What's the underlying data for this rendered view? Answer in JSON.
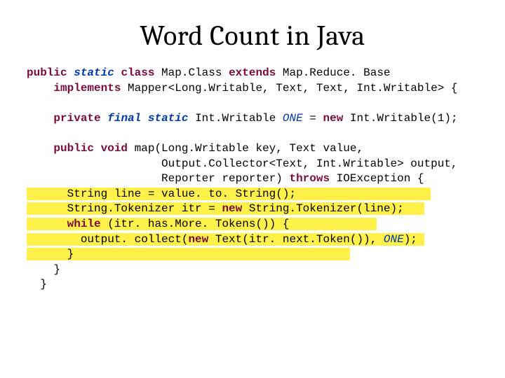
{
  "title": "Word Count in Java",
  "code": {
    "l1a": "public",
    "l1b": " ",
    "l1c": "static",
    "l1d": " ",
    "l1e": "class",
    "l1f": " Map.Class ",
    "l1g": "extends",
    "l1h": " Map.Reduce. Base",
    "l2a": "    ",
    "l2b": "implements",
    "l2c": " Mapper<Long.Writable, Text, Text, Int.Writable> {",
    "l3": " ",
    "l4a": "    ",
    "l4b": "private",
    "l4c": " ",
    "l4d": "final",
    "l4e": " ",
    "l4f": "static",
    "l4g": " Int.Writable ",
    "l4h": "ONE",
    "l4i": " = ",
    "l4j": "new",
    "l4k": " Int.Writable(1);",
    "l5": " ",
    "l6a": "    ",
    "l6b": "public",
    "l6c": " ",
    "l6d": "void",
    "l6e": " map(Long.Writable key, Text value,",
    "l7": "                    Output.Collector<Text, Int.Writable> output,",
    "l8a": "                    Reporter reporter) ",
    "l8b": "throws",
    "l8c": " IOException {",
    "l9": "      String line = value. to. String();                    ",
    "l10a": "      String.Tokenizer itr = ",
    "l10b": "new",
    "l10c": " String.Tokenizer(line);   ",
    "l11a": "      ",
    "l11b": "while",
    "l11c": " (itr. has.More. Tokens()) {             ",
    "l12a": "        output. collect(",
    "l12b": "new",
    "l12c": " Text(itr. next.Token()), ",
    "l12d": "ONE",
    "l12e": "); ",
    "l13": "      }                                         ",
    "l14": "    }",
    "l15": "  }"
  }
}
